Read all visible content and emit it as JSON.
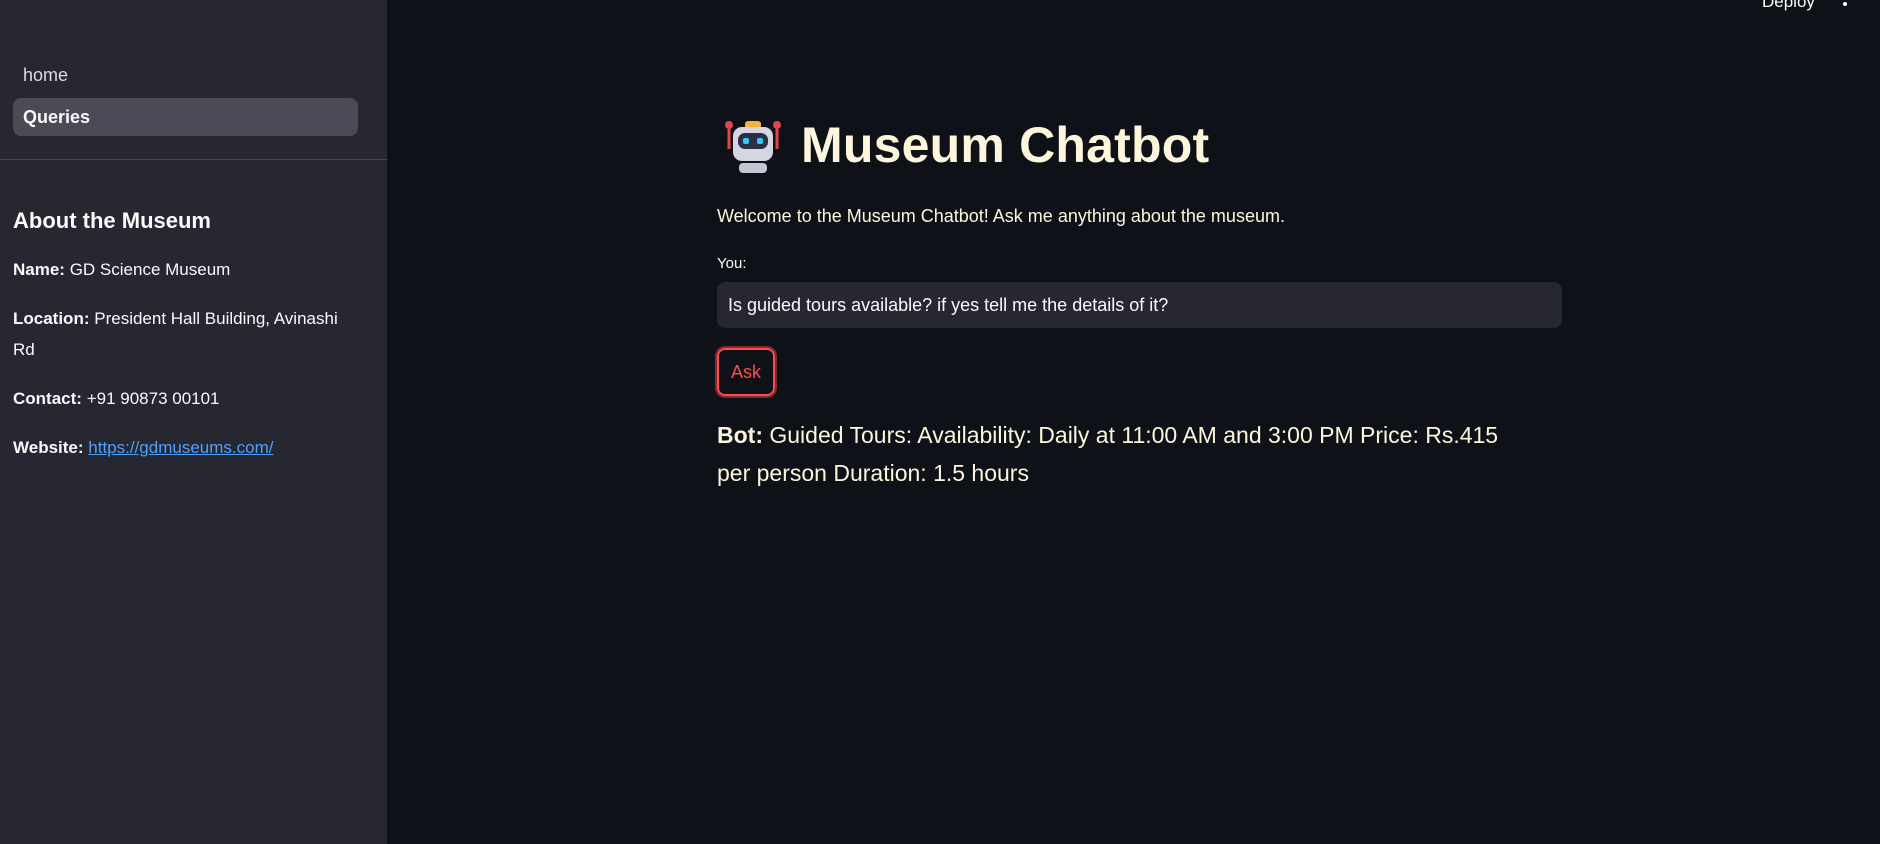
{
  "header": {
    "deploy_label": "Deploy",
    "menu_icon": "kebab-menu-icon"
  },
  "sidebar": {
    "nav": [
      {
        "label": "home",
        "active": false
      },
      {
        "label": "Queries",
        "active": true
      }
    ],
    "about": {
      "heading": "About the Museum",
      "name_label": "Name:",
      "name_value": "GD Science Museum",
      "location_label": "Location:",
      "location_value": "President Hall Building, Avinashi Rd",
      "contact_label": "Contact:",
      "contact_value": "+91 90873 00101",
      "website_label": "Website:",
      "website_value": "https://gdmuseums.com/"
    }
  },
  "main": {
    "icon": "robot-icon",
    "title": "Museum Chatbot",
    "welcome": "Welcome to the Museum Chatbot! Ask me anything about the museum.",
    "input_label": "You:",
    "input_value": "Is guided tours available? if yes tell me the details of it?",
    "ask_label": "Ask",
    "bot_label": "Bot:",
    "bot_response": "Guided Tours: Availability: Daily at 11:00 AM and 3:00 PM Price: Rs.415 per person Duration: 1.5 hours"
  },
  "colors": {
    "background": "#0e1117",
    "sidebar": "#262730",
    "accent": "#ff4b4b",
    "link": "#4ea1ff",
    "text_cream": "#fdf6dc"
  }
}
